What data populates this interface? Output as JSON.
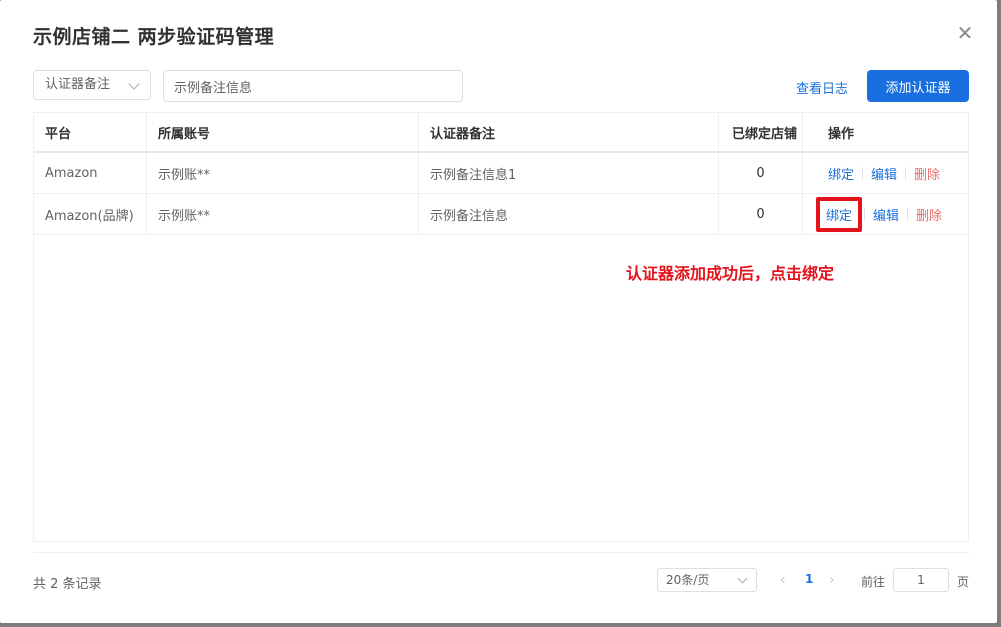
{
  "dialog": {
    "title": "示例店铺二 两步验证码管理",
    "close_icon": "close-icon"
  },
  "filters": {
    "select_value": "认证器备注",
    "input_value": "示例备注信息"
  },
  "actions": {
    "view_log": "查看日志",
    "add_authenticator": "添加认证器"
  },
  "table": {
    "headers": [
      "平台",
      "所属账号",
      "认证器备注",
      "已绑定店铺",
      "操作"
    ],
    "rows": [
      {
        "platform": "Amazon",
        "account": "示例账**",
        "note": "示例备注信息1",
        "bound": "0",
        "op_bind": "绑定",
        "op_edit": "编辑",
        "op_delete": "删除"
      },
      {
        "platform": "Amazon(品牌)",
        "account": "示例账**",
        "note": "示例备注信息",
        "bound": "0",
        "op_bind": "绑定",
        "op_edit": "编辑",
        "op_delete": "删除"
      }
    ]
  },
  "annotation": {
    "text": "认证器添加成功后，点击绑定",
    "color": "#e3121b"
  },
  "pagination": {
    "total": "共 2 条记录",
    "page_size": "20条/页",
    "prev_icon": "chevron-left-icon",
    "current_page": "1",
    "next_icon": "chevron-right-icon",
    "goto_label": "前往",
    "goto_value": "1",
    "page_suffix": "页"
  },
  "colors": {
    "primary": "#1a6fe0",
    "link": "#1c6fd8",
    "danger_link": "#e86a6a",
    "highlight": "#e3121b"
  }
}
